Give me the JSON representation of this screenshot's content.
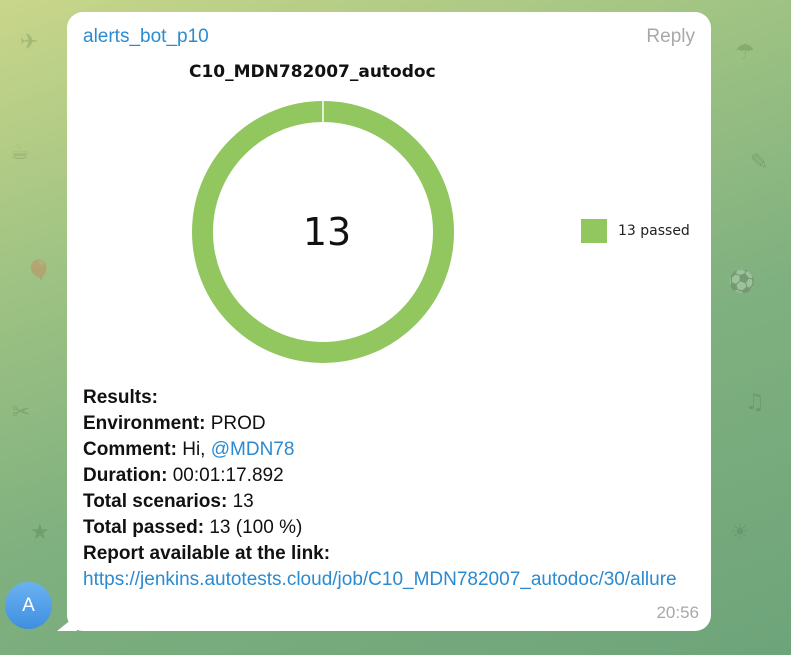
{
  "message": {
    "sender": "alerts_bot_p10",
    "reply_label": "Reply",
    "time": "20:56",
    "avatar_letter": "A"
  },
  "chart_data": {
    "type": "pie",
    "title": "C10_MDN782007_autodoc",
    "center_label": "13",
    "slices": [
      {
        "name": "13 passed",
        "value": 13
      }
    ],
    "colors": [
      "#92c65f"
    ],
    "legend": [
      "13 passed"
    ],
    "legend_position": "right"
  },
  "results": {
    "heading": "Results:",
    "environment_label": "Environment:",
    "environment_value": "PROD",
    "comment_label": "Comment:",
    "comment_text": "Hi,",
    "comment_mention": "@MDN78",
    "duration_label": "Duration:",
    "duration_value": "00:01:17.892",
    "total_scenarios_label": "Total scenarios:",
    "total_scenarios_value": "13",
    "total_passed_label": "Total passed:",
    "total_passed_value": "13 (100 %)",
    "report_label": "Report available at the link:",
    "report_link": "https://jenkins.autotests.cloud/job/C10_MDN782007_autodoc/30/allure"
  },
  "colors": {
    "link": "#2b8ad0",
    "muted": "#a8a8a8",
    "passed": "#92c65f"
  }
}
